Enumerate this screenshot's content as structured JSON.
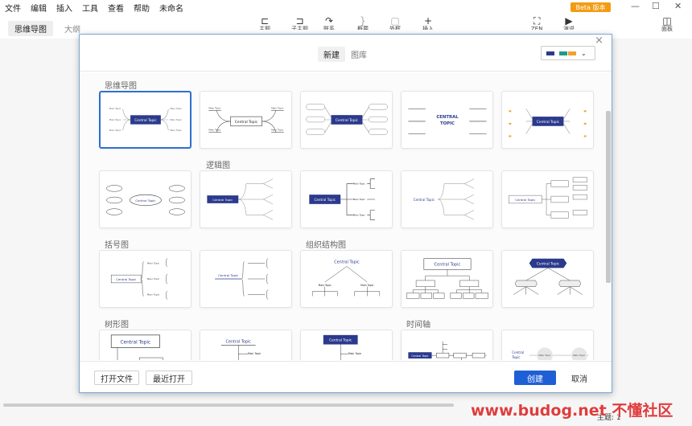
{
  "menu": {
    "items": [
      "文件",
      "编辑",
      "插入",
      "工具",
      "查看",
      "帮助",
      "未命名"
    ],
    "badge": "Beta 版本"
  },
  "window": {
    "min": "—",
    "max": "☐",
    "close": "✕"
  },
  "toolbar": {
    "items": [
      {
        "icon": "subtopic-icon",
        "label": "主题"
      },
      {
        "icon": "child-topic-icon",
        "label": "子主题"
      },
      {
        "icon": "link-icon",
        "label": "联系"
      },
      {
        "icon": "summary-icon",
        "label": "概要"
      },
      {
        "icon": "boundary-icon",
        "label": "外框"
      },
      {
        "icon": "plus-icon",
        "label": "插入"
      },
      {
        "icon": "zen-icon",
        "label": "ZEN"
      },
      {
        "icon": "presentation-icon",
        "label": "演说"
      },
      {
        "icon": "panel-icon",
        "label": "面板"
      }
    ]
  },
  "view_tabs": [
    "思维导图",
    "大纲"
  ],
  "status": "主题: 1",
  "watermark": "www.budog.net 不懂社区",
  "dialog": {
    "tabs": [
      "新建",
      "图库"
    ],
    "theme_colors": [
      "#2b3a8c",
      "#1e9a8a",
      "#f0a030"
    ],
    "categories": {
      "mindmap": "思维导图",
      "logic": "逻辑图",
      "brace": "括号图",
      "org": "组织结构图",
      "tree": "树形图",
      "timeline": "时间轴"
    },
    "footer": {
      "open_file": "打开文件",
      "recent": "最近打开",
      "create": "创建",
      "cancel": "取消"
    }
  },
  "template_text": {
    "central": "Central Topic",
    "central_upper": "CENTRAL TOPIC",
    "main": "Main Topic",
    "sub": "Subtopic"
  },
  "colors": {
    "accent": "#2b3a8c",
    "selection": "#2f6fd3",
    "primary_button": "#1f5fd6"
  }
}
